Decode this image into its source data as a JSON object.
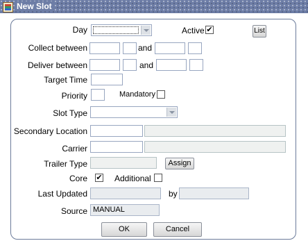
{
  "window": {
    "title": "New Slot"
  },
  "labels": {
    "day": "Day",
    "active": "Active",
    "collect_between": "Collect between",
    "and1": "and",
    "deliver_between": "Deliver between",
    "and2": "and",
    "target_time": "Target Time",
    "priority": "Priority",
    "mandatory": "Mandatory",
    "slot_type": "Slot Type",
    "secondary_location": "Secondary Location",
    "carrier": "Carrier",
    "trailer_type": "Trailer Type",
    "core": "Core",
    "additional": "Additional",
    "last_updated": "Last Updated",
    "by": "by",
    "source": "Source"
  },
  "checks": {
    "active": "✔",
    "mandatory": "",
    "core": "✔",
    "additional": ""
  },
  "values": {
    "source": "MANUAL"
  },
  "buttons": {
    "list": "List",
    "assign": "Assign",
    "ok": "OK",
    "cancel": "Cancel"
  }
}
